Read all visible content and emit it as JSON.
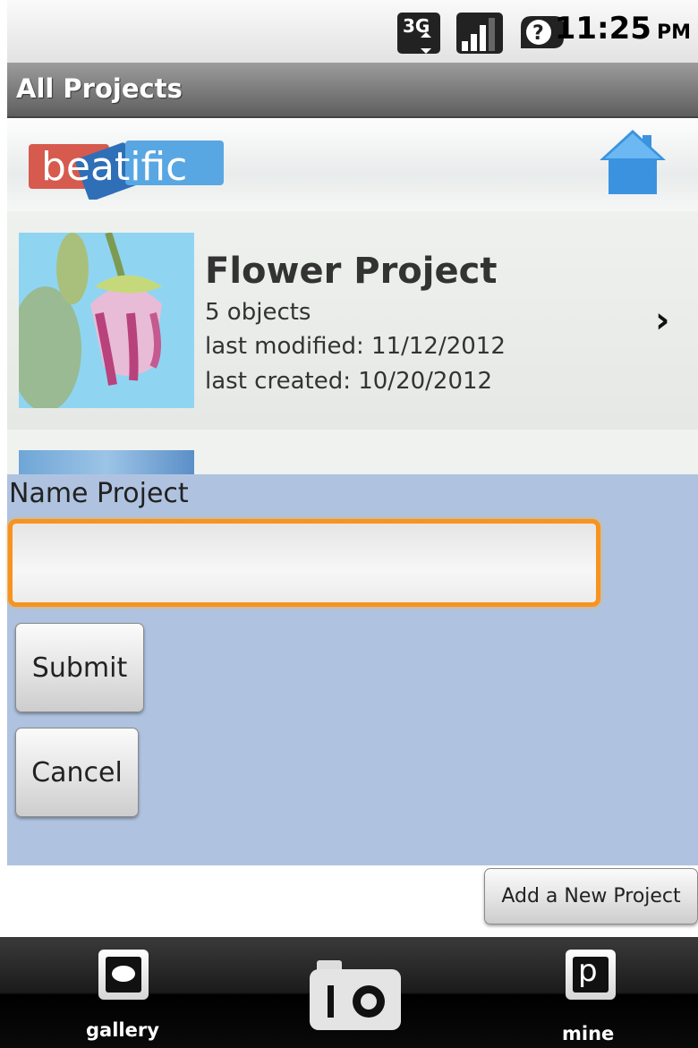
{
  "status_bar": {
    "network_label": "3G",
    "time": "11:25",
    "ampm": "PM",
    "icons": [
      "3g-data-icon",
      "signal-strength-icon",
      "unknown-status-icon"
    ]
  },
  "title_bar": {
    "title": "All Projects"
  },
  "header": {
    "logo_text": "beatific",
    "home_icon": "home-icon"
  },
  "projects": [
    {
      "title": "Flower Project",
      "objects": "5 objects",
      "last_modified": "last modified: 11/12/2012",
      "last_created": "last created: 10/20/2012",
      "chevron": "›"
    }
  ],
  "dialog": {
    "label": "Name Project",
    "input_value": "",
    "submit_label": "Submit",
    "cancel_label": "Cancel"
  },
  "actions": {
    "add_project_label": "Add a New Project"
  },
  "tabs": [
    {
      "label": "gallery",
      "icon": "gallery-icon"
    },
    {
      "label": "",
      "icon": "camera-icon"
    },
    {
      "label": "mine",
      "icon": "mine-icon"
    }
  ],
  "colors": {
    "dialog_bg": "#afc3e0",
    "input_border": "#f7931e",
    "title_bar": "#7a7a7a",
    "logo_red": "#d65a4e",
    "logo_blue": "#3f8fd6"
  }
}
